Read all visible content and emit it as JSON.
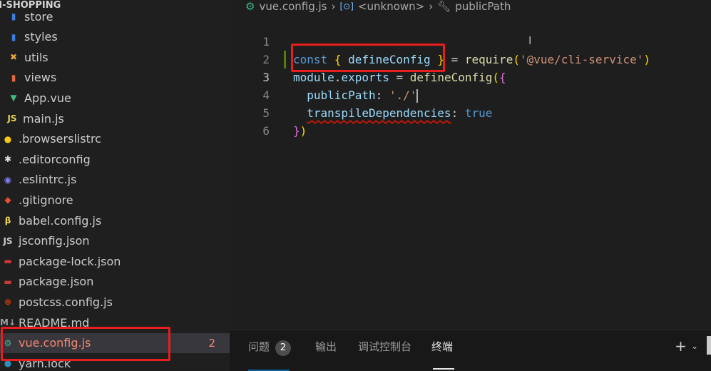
{
  "explorer": {
    "title": "LI-SHOPPING",
    "items": [
      {
        "label": "store",
        "icon": "folder-icon",
        "glyph": "▮",
        "color": "#3e7ee0"
      },
      {
        "label": "styles",
        "icon": "folder-styles-icon",
        "glyph": "▮",
        "color": "#3e7ee0"
      },
      {
        "label": "utils",
        "icon": "folder-utils-icon",
        "glyph": "✖",
        "color": "#e8a33d"
      },
      {
        "label": "views",
        "icon": "folder-views-icon",
        "glyph": "▮",
        "color": "#e0673e"
      },
      {
        "label": "App.vue",
        "icon": "vue-icon",
        "glyph": "▼",
        "color": "#41b883"
      },
      {
        "label": "main.js",
        "icon": "js-icon",
        "glyph": "JS",
        "color": "#e8d44d"
      },
      {
        "label": ".browserslistrc",
        "icon": "browserslist-icon",
        "glyph": "●",
        "color": "#f6c915"
      },
      {
        "label": ".editorconfig",
        "icon": "editorconfig-icon",
        "glyph": "✱",
        "color": "#e0e0e0"
      },
      {
        "label": ".eslintrc.js",
        "icon": "eslint-icon",
        "glyph": "◉",
        "color": "#8080f2"
      },
      {
        "label": ".gitignore",
        "icon": "git-icon",
        "glyph": "◆",
        "color": "#e94e31"
      },
      {
        "label": "babel.config.js",
        "icon": "babel-icon",
        "glyph": "β",
        "color": "#f5da55"
      },
      {
        "label": "jsconfig.json",
        "icon": "jsconfig-icon",
        "glyph": "JS",
        "color": "#cccccc"
      },
      {
        "label": "package-lock.json",
        "icon": "npm-icon",
        "glyph": "▬",
        "color": "#cb3837"
      },
      {
        "label": "package.json",
        "icon": "npm-icon",
        "glyph": "▬",
        "color": "#cb3837"
      },
      {
        "label": "postcss.config.js",
        "icon": "postcss-icon",
        "glyph": "⊛",
        "color": "#dd3a0a"
      },
      {
        "label": "README.md",
        "icon": "markdown-icon",
        "glyph": "M↓",
        "color": "#9e9e9e"
      },
      {
        "label": "vue.config.js",
        "icon": "vue-config-icon",
        "glyph": "⚙",
        "color": "#41b883",
        "active": true,
        "badge": "2"
      },
      {
        "label": "yarn.lock",
        "icon": "yarn-icon",
        "glyph": "●",
        "color": "#2c8ebb"
      }
    ]
  },
  "breadcrumb": {
    "file": "vue.config.js",
    "symbol1": "<unknown>",
    "symbol2": "publicPath"
  },
  "code": {
    "line_numbers": [
      "1",
      "2",
      "3",
      "4",
      "5",
      "6"
    ],
    "l1": {
      "kw": "const",
      "open": "{",
      "name": "defineConfig",
      "close": "}",
      "eq": "=",
      "fn": "require",
      "paren_open": "(",
      "str": "'@vue/cli-service'",
      "paren_close": ")"
    },
    "l2": {
      "module": "module",
      "dot": ".",
      "exports": "exports",
      "eq": "=",
      "fn": "defineConfig",
      "paren": "(",
      "brace": "{"
    },
    "l3": {
      "key": "publicPath",
      "colon": ":",
      "str": "'./'"
    },
    "l4": {
      "key": "transpileDependencies",
      "colon": ":",
      "val": "true"
    },
    "l5": {
      "brace": "}",
      "paren": ")"
    }
  },
  "panel": {
    "tabs": [
      {
        "label": "问题",
        "badge": "2"
      },
      {
        "label": "输出"
      },
      {
        "label": "调试控制台"
      },
      {
        "label": "终端",
        "active": true
      }
    ],
    "add_glyph": "+",
    "chevron_glyph": "⌄"
  }
}
